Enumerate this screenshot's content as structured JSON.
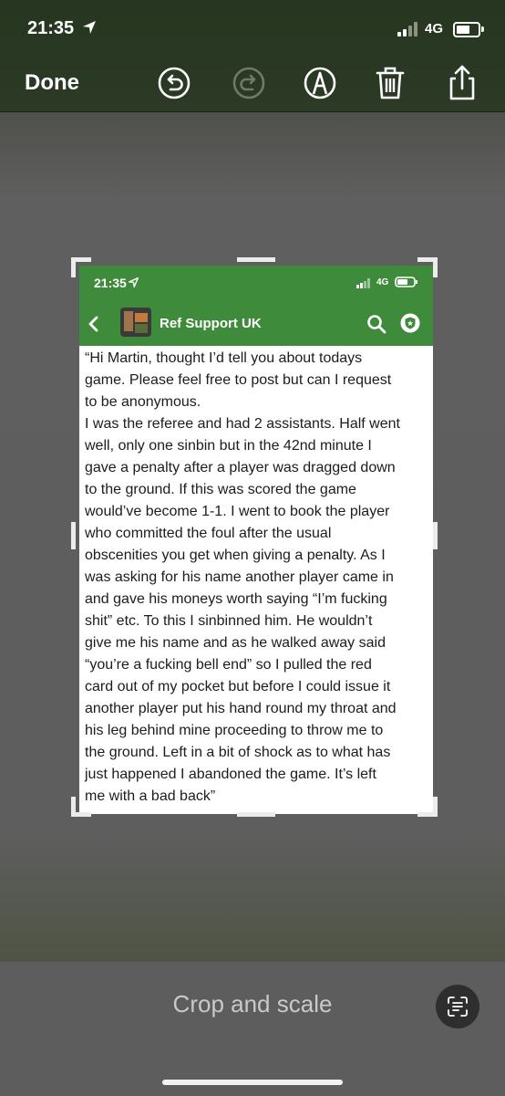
{
  "status_bar": {
    "time": "21:35",
    "network": "4G"
  },
  "toolbar": {
    "done_label": "Done",
    "tools": [
      "undo-icon",
      "redo-icon",
      "markup-pen-icon",
      "trash-icon",
      "share-icon"
    ]
  },
  "screenshot": {
    "status_bar": {
      "time": "21:35",
      "network": "4G"
    },
    "header": {
      "group_name": "Ref Support UK"
    },
    "message": "“Hi Martin, thought I’d tell you about todays\ngame. Please feel free to post but can I request\nto be anonymous.\nI was the referee and had 2 assistants. Half went\nwell, only one sinbin but in the 42nd minute I\ngave a penalty after a player was dragged down\nto the ground. If this was scored the game\nwould’ve become 1-1. I went to book the player\nwho committed the foul after the usual\nobscenities you get when giving a penalty. As I\nwas asking for his name another player came in\nand gave his moneys worth saying “I’m fucking\nshit” etc. To this I sinbinned him. He wouldn’t\ngive me his name and as he walked away said\n“you’re a fucking bell end” so I pulled the red\ncard out of my pocket but before I could issue it\nanother player put his hand round my throat and\nhis leg behind mine proceeding to throw me to\nthe ground. Left in a bit of shock as to what has\njust happened I abandoned the game. It’s left\nme with a bad back”"
  },
  "bottom": {
    "mode_label": "Crop and scale"
  },
  "colors": {
    "header_green": "#3f8b3c",
    "top_bar": "#2c3a26"
  }
}
